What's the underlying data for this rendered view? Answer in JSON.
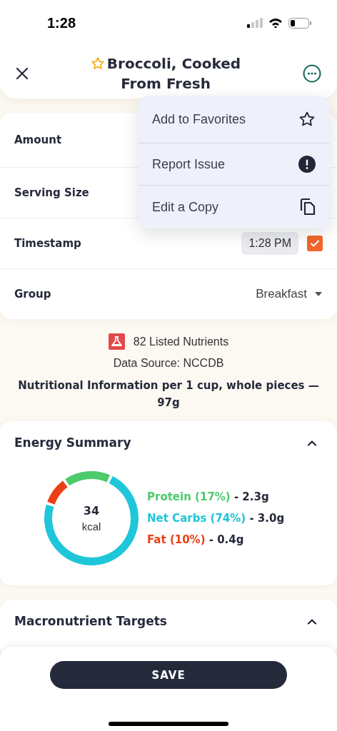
{
  "status_bar": {
    "time": "1:28"
  },
  "header": {
    "title": "Broccoli, Cooked From Fresh"
  },
  "menu": {
    "items": [
      {
        "label": "Add to Favorites",
        "kind": "star"
      },
      {
        "label": "Report Issue",
        "kind": "alert"
      },
      {
        "label": "Edit a Copy",
        "kind": "copy"
      }
    ]
  },
  "fields": [
    {
      "label": "Amount",
      "kind": "plain"
    },
    {
      "label": "Serving Size",
      "kind": "plain"
    },
    {
      "label": "Timestamp",
      "kind": "time",
      "value": "1:28 PM",
      "checked": true
    },
    {
      "label": "Group",
      "kind": "dropdown",
      "value": "Breakfast"
    }
  ],
  "info": {
    "nutrients": "82 Listed Nutrients",
    "source": "Data Source: NCCDB",
    "basis": "Nutritional Information per 1 cup, whole pieces — 97g"
  },
  "energy_summary": {
    "title": "Energy Summary",
    "expanded": true,
    "calories": "34",
    "unit": "kcal",
    "chart_data": {
      "type": "donut",
      "categories": [
        "Protein",
        "Net Carbs",
        "Fat"
      ],
      "values": [
        17,
        74,
        10
      ]
    },
    "legend": [
      {
        "share": "(17%)",
        "amount": "- 2.3g",
        "color": "#4ccb6c"
      },
      {
        "share": "(74%)",
        "amount": "- 3.0g",
        "color": "#1ec6d9"
      },
      {
        "share": "(10%)",
        "amount": "- 0.4g",
        "color": "#ea3f17"
      }
    ]
  },
  "macronutrient_targets": {
    "title": "Macronutrient Targets",
    "expanded": true
  },
  "save_button": {
    "label": "SAVE"
  }
}
